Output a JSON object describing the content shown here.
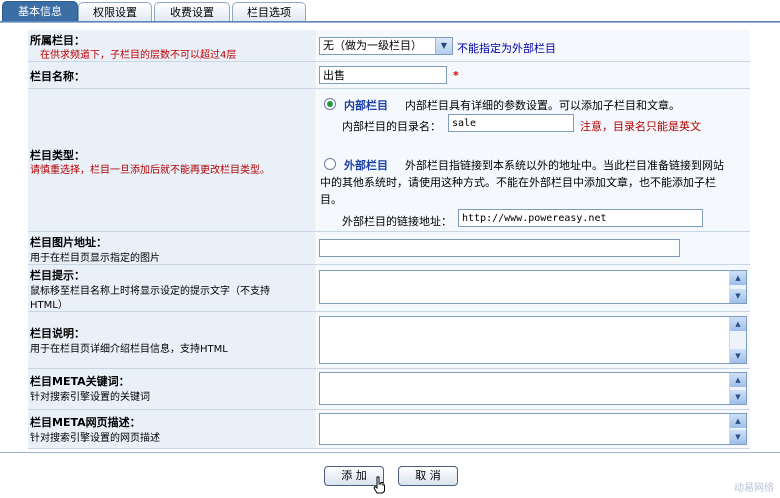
{
  "tabs": [
    {
      "label": "基本信息",
      "active": true
    },
    {
      "label": "权限设置",
      "active": false
    },
    {
      "label": "收费设置",
      "active": false
    },
    {
      "label": "栏目选项",
      "active": false
    }
  ],
  "parent": {
    "title": "所属栏目：",
    "note": "在供求频道下，子栏目的层数不可以超过4层",
    "selected": "无（做为一级栏目）",
    "hint": "不能指定为外部栏目"
  },
  "name": {
    "title": "栏目名称：",
    "value": "出售",
    "required": "*"
  },
  "type": {
    "title": "栏目类型：",
    "note": "请慎重选择，栏目一旦添加后就不能再更改栏目类型。",
    "internal_label": "内部栏目",
    "internal_desc": "内部栏目具有详细的参数设置。可以添加子栏目和文章。",
    "dir_label": "内部栏目的目录名：",
    "dir_value": "sale",
    "dir_hint": "注意，目录名只能是英文",
    "external_label": "外部栏目",
    "external_desc1": "外部栏目指链接到本系统以外的地址中。当此栏目准备链接到网站",
    "external_desc2": "中的其他系统时，请使用这种方式。不能在外部栏目中添加文章，也不能添加子栏",
    "external_desc3": "目。",
    "link_label": "外部栏目的链接地址：",
    "link_value": "http://www.powereasy.net"
  },
  "image": {
    "title": "栏目图片地址：",
    "note": "用于在栏目页显示指定的图片",
    "value": ""
  },
  "tips": {
    "title": "栏目提示：",
    "note1": "鼠标移至栏目名称上时将显示设定的提示文字（不支持",
    "note2": "HTML）"
  },
  "desc": {
    "title": "栏目说明：",
    "note": "用于在栏目页详细介绍栏目信息，支持HTML"
  },
  "keywords": {
    "title": "栏目META关键词：",
    "note": "针对搜索引擎设置的关键词"
  },
  "meta_desc": {
    "title": "栏目META网页描述：",
    "note": "针对搜索引擎设置的网页描述"
  },
  "buttons": {
    "add": "添 加",
    "cancel": "取 消"
  },
  "watermark": "动易网络",
  "icons": [
    "dropdown-arrow-icon",
    "scroll-up-icon",
    "scroll-down-icon",
    "radio-icon",
    "hand-cursor-icon"
  ]
}
